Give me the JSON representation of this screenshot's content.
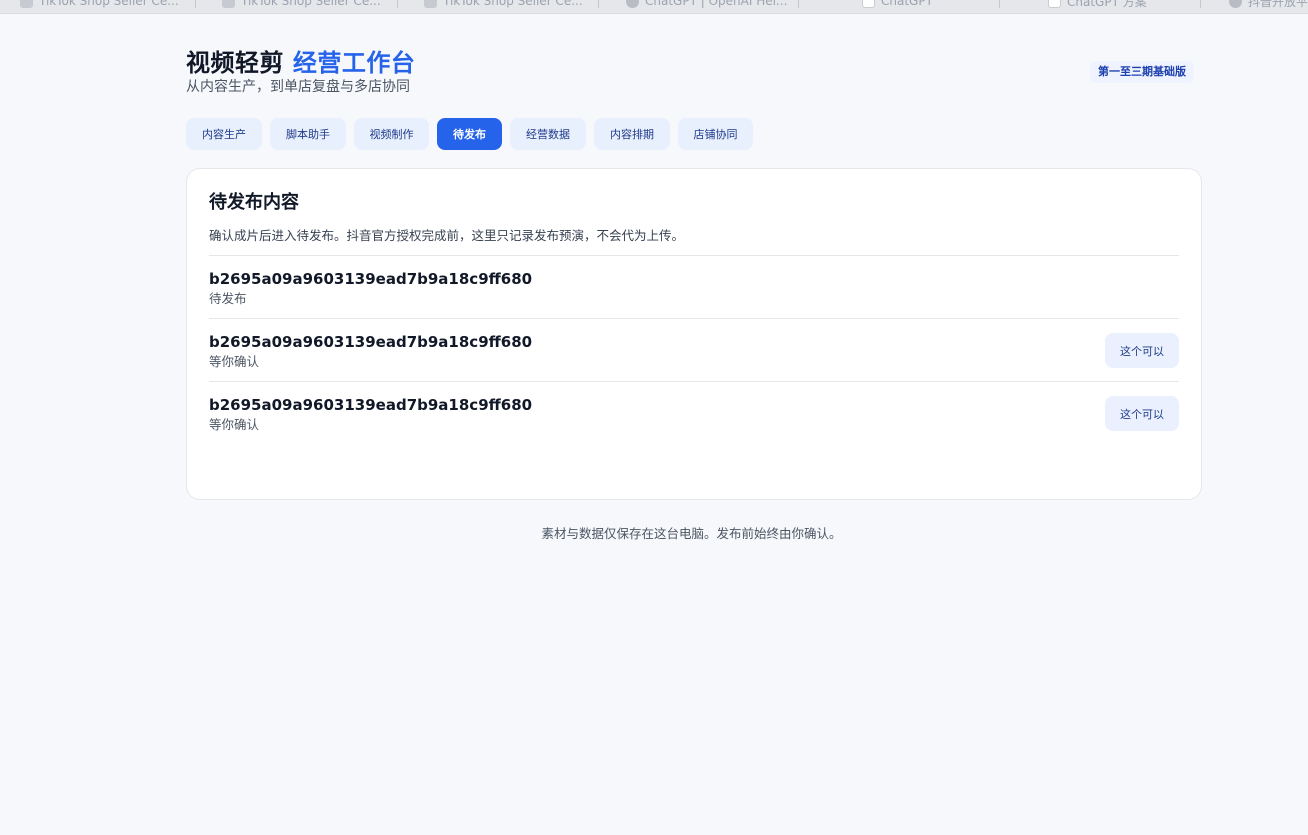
{
  "browser_tabs": [
    {
      "title": "TikTok Shop Seller Ce...",
      "icon": "shop-favicon-icon"
    },
    {
      "title": "TikTok Shop Seller Ce...",
      "icon": "shop-favicon-icon"
    },
    {
      "title": "TikTok Shop Seller Ce...",
      "icon": "shop-favicon-icon"
    },
    {
      "title": "ChatGPT | OpenAI Hel...",
      "icon": "openai-favicon-icon"
    },
    {
      "title": "ChatGPT",
      "icon": "openai-favicon-icon"
    },
    {
      "title": "ChatGPT 方案",
      "icon": "openai-favicon-icon"
    },
    {
      "title": "抖音开放平",
      "icon": "douyin-favicon-icon"
    }
  ],
  "header": {
    "title_main": "视频轻剪",
    "title_accent": "经营工作台",
    "subtitle": "从内容生产，到单店复盘与多店协同",
    "edition_badge": "第一至三期基础版",
    "accent_color": "#2563eb"
  },
  "nav": {
    "tabs": [
      {
        "label": "内容生产",
        "active": false
      },
      {
        "label": "脚本助手",
        "active": false
      },
      {
        "label": "视频制作",
        "active": false
      },
      {
        "label": "待发布",
        "active": true
      },
      {
        "label": "经营数据",
        "active": false
      },
      {
        "label": "内容排期",
        "active": false
      },
      {
        "label": "店铺协同",
        "active": false
      }
    ]
  },
  "main": {
    "title": "待发布内容",
    "description": "确认成片后进入待发布。抖音官方授权完成前，这里只记录发布预演，不会代为上传。",
    "items": [
      {
        "id": "b2695a09a9603139ead7b9a18c9ff680",
        "status": "待发布",
        "action": ""
      },
      {
        "id": "b2695a09a9603139ead7b9a18c9ff680",
        "status": "等你确认",
        "action": "这个可以"
      },
      {
        "id": "b2695a09a9603139ead7b9a18c9ff680",
        "status": "等你确认",
        "action": "这个可以"
      }
    ]
  },
  "footer": {
    "note": "素材与数据仅保存在这台电脑。发布前始终由你确认。"
  }
}
